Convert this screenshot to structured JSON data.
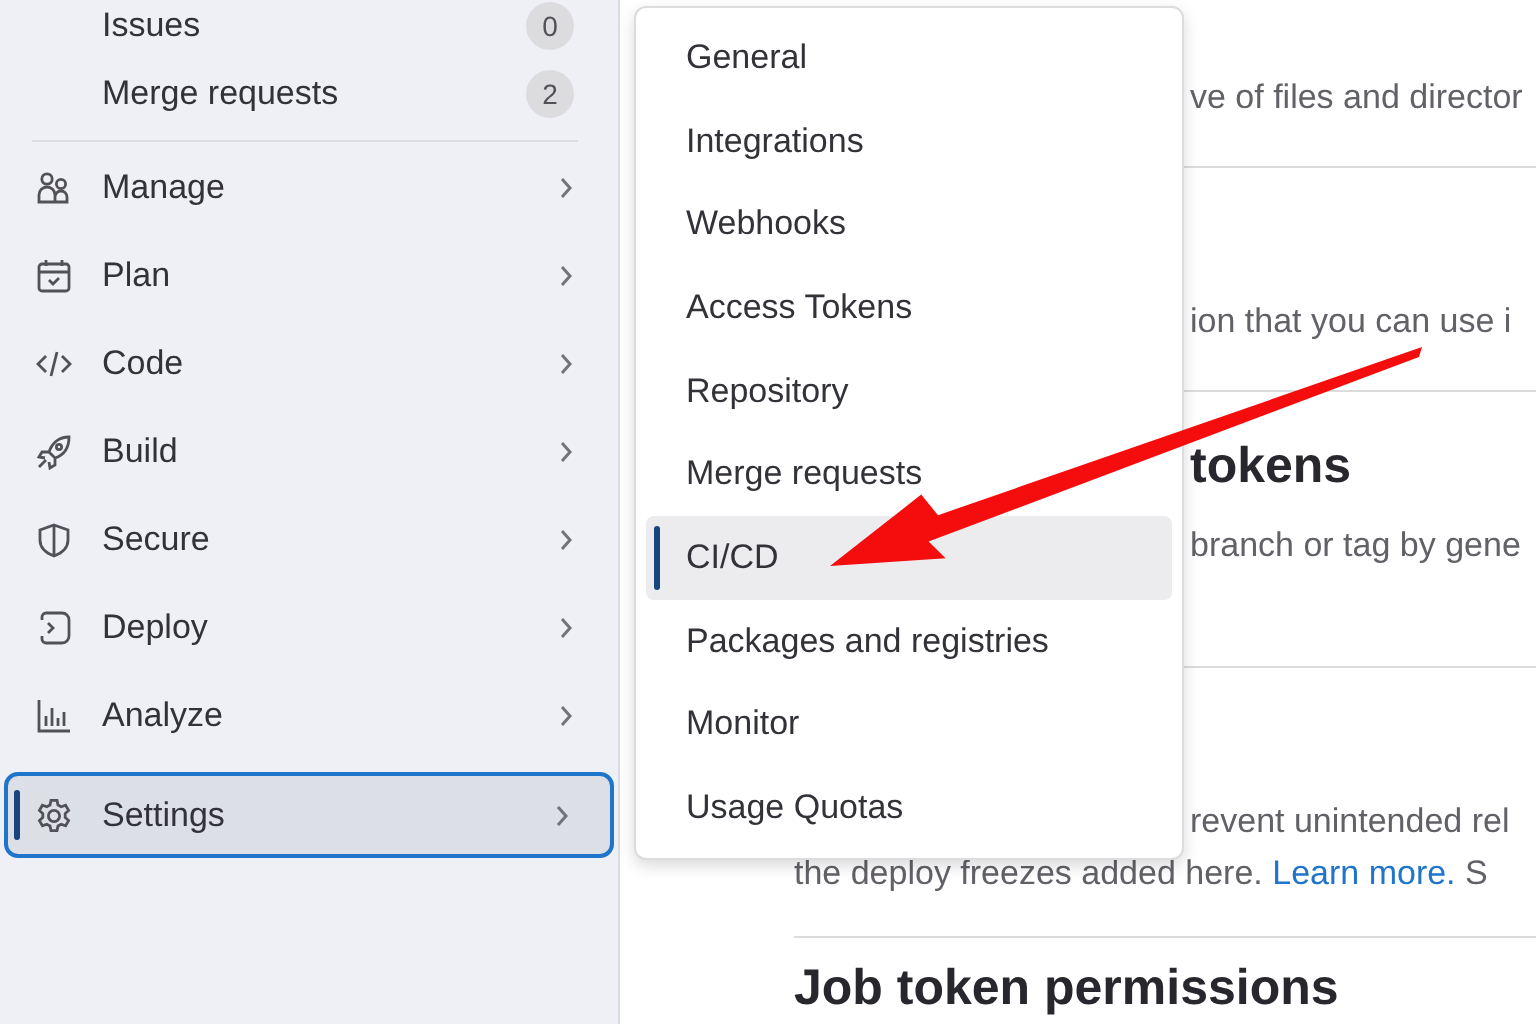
{
  "sidebar": {
    "items": [
      {
        "label": "Issues",
        "kind": "count",
        "badge": "0",
        "selected": false
      },
      {
        "label": "Merge requests",
        "kind": "count",
        "badge": "2",
        "selected": false
      },
      {
        "label": "Manage",
        "kind": "group",
        "selected": false
      },
      {
        "label": "Plan",
        "kind": "group",
        "selected": false
      },
      {
        "label": "Code",
        "kind": "group",
        "selected": false
      },
      {
        "label": "Build",
        "kind": "group",
        "selected": false
      },
      {
        "label": "Secure",
        "kind": "group",
        "selected": false
      },
      {
        "label": "Deploy",
        "kind": "group",
        "selected": false
      },
      {
        "label": "Analyze",
        "kind": "group",
        "selected": false
      },
      {
        "label": "Settings",
        "kind": "group",
        "selected": true
      }
    ]
  },
  "settings_menu": {
    "items": [
      {
        "label": "General",
        "selected": false
      },
      {
        "label": "Integrations",
        "selected": false
      },
      {
        "label": "Webhooks",
        "selected": false
      },
      {
        "label": "Access Tokens",
        "selected": false
      },
      {
        "label": "Repository",
        "selected": false
      },
      {
        "label": "Merge requests",
        "selected": false
      },
      {
        "label": "CI/CD",
        "selected": true
      },
      {
        "label": "Packages and registries",
        "selected": false
      },
      {
        "label": "Monitor",
        "selected": false
      },
      {
        "label": "Usage Quotas",
        "selected": false
      }
    ]
  },
  "content": {
    "sections": [
      {
        "description": "ve of files and director"
      },
      {
        "description": "ion that you can use i"
      },
      {
        "heading": "tokens",
        "description": "branch or tag by gene"
      },
      {
        "description": "revent unintended rel",
        "text": "the deploy freezes added here.",
        "link": "Learn more.",
        "tail": "S"
      },
      {
        "heading": "Job token permissions"
      }
    ]
  }
}
